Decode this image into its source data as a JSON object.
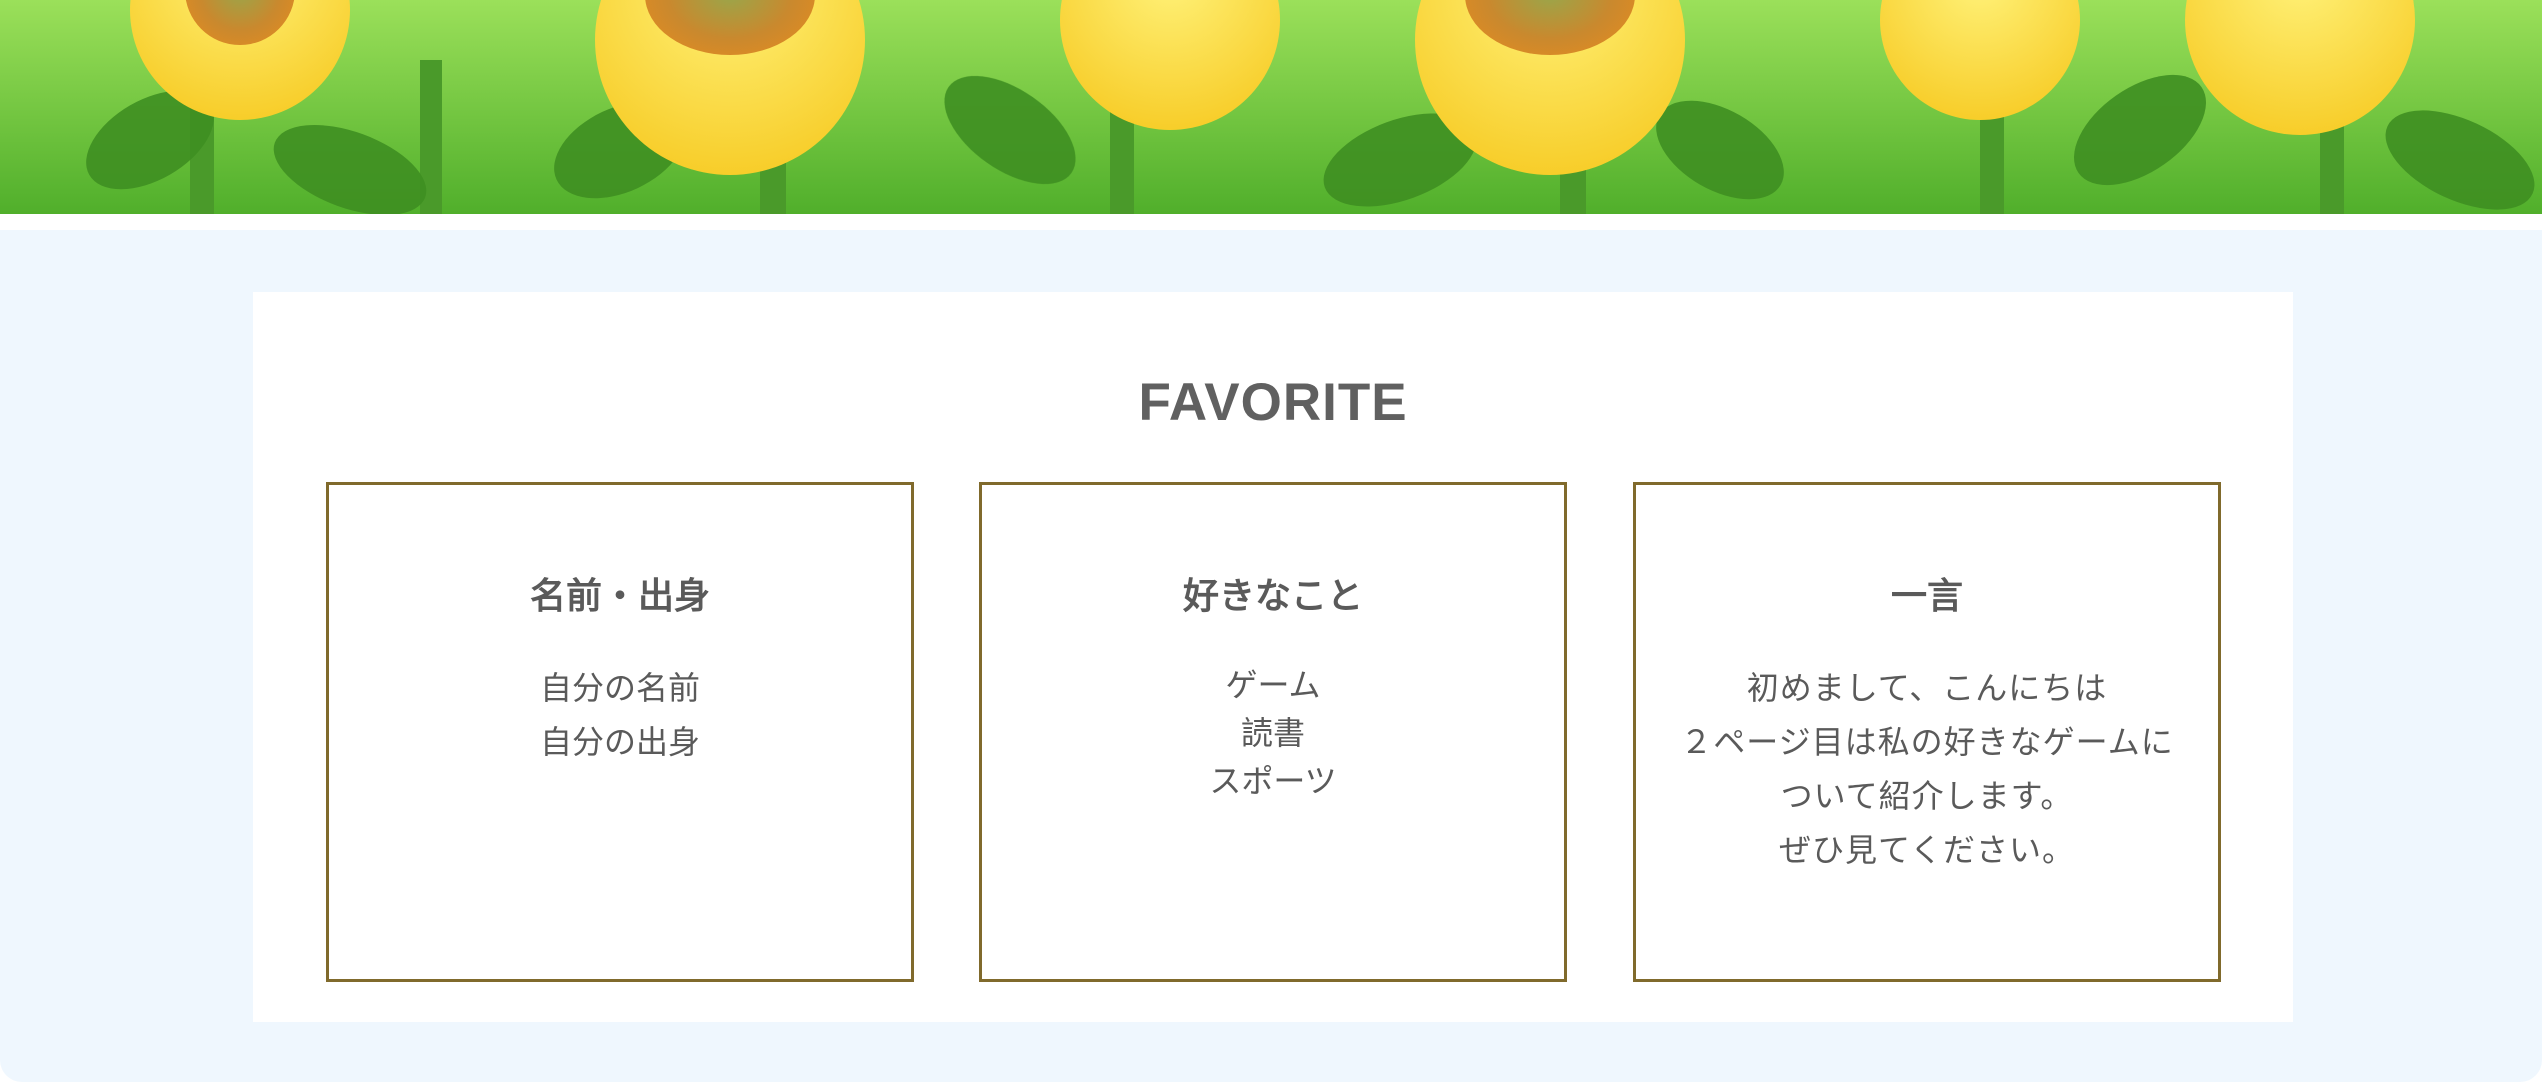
{
  "hero": {
    "image": "sunflower-field-banner"
  },
  "favorite": {
    "title": "FAVORITE",
    "cards": [
      {
        "title": "名前・出身",
        "lines": [
          "自分の名前",
          "自分の出身"
        ]
      },
      {
        "title": "好きなこと",
        "lines": [
          "ゲーム",
          "読書",
          "スポーツ"
        ]
      },
      {
        "title": "一言",
        "lines": [
          "初めまして、こんにちは",
          "２ページ目は私の好きなゲームに",
          "ついて紹介します。",
          "ぜひ見てください。"
        ]
      }
    ]
  },
  "colors": {
    "page_background": "#eff7fe",
    "panel_background": "#ffffff",
    "card_border": "#806a2c",
    "text": "#5a5a5a"
  }
}
